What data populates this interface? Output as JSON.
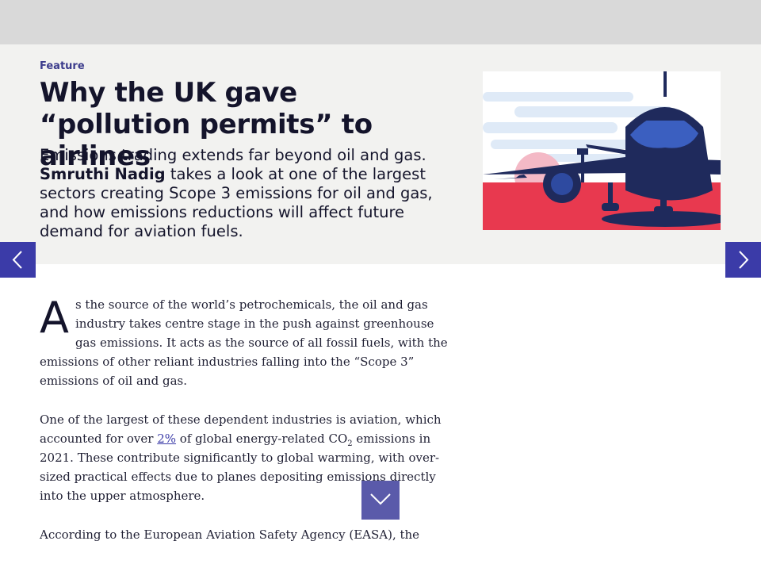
{
  "article": {
    "kicker": "Feature",
    "title": "Why the UK gave “pollution permits” to airlines",
    "standfirst_intro": "Emissions trading extends far beyond oil and gas.",
    "author": "Smruthi Nadig",
    "standfirst_rest": "takes a look at one of the largest sectors creating Scope 3 emissions for oil and gas, and how emissions reductions will affect future demand for aviation fuels.",
    "hero_image_icon": "airplane-illustration"
  },
  "body": {
    "p1_dropcap": "A",
    "p1_text": "s the source of the world’s petrochemicals, the oil and gas industry takes centre stage in the push against greenhouse gas emissions. It acts as the source of all fossil fuels, with the emissions of other reliant industries falling into the “Scope 3” emissions of oil and gas.",
    "p2_before": "One of the largest of these dependent industries is aviation, which accounted for over ",
    "p2_link": "2%",
    "p2_mid": " of global energy-related CO",
    "p2_sub": "2",
    "p2_after": " emissions in 2021. These contribute significantly to global warming, with over-sized practical effects due to planes depositing emissions directly into the upper atmosphere.",
    "p3_text": "According to the European Aviation Safety Agency (EASA), the"
  },
  "nav": {
    "prev_icon": "chevron-left-icon",
    "next_icon": "chevron-right-icon",
    "scroll_icon": "chevron-down-icon"
  },
  "colors": {
    "accent": "#3b3ba8",
    "hero_bg": "#f2f2f0",
    "topbar": "#d9d9d9",
    "illustration_red": "#e8394f",
    "illustration_navy": "#1f2a5c"
  }
}
